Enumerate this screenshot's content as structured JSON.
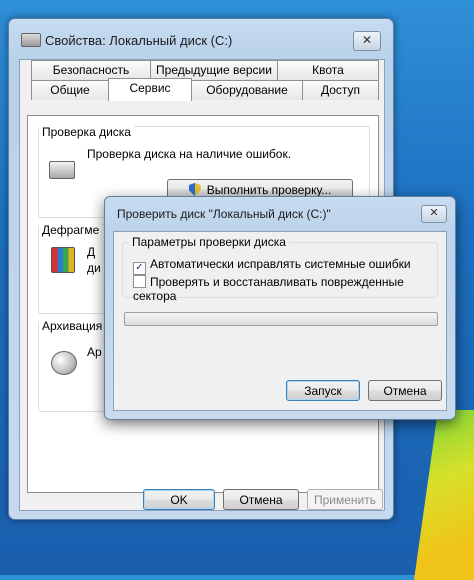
{
  "window": {
    "title": "Свойства: Локальный диск (C:)",
    "close_glyph": "✕",
    "tabs_row1": [
      "Безопасность",
      "Предыдущие версии",
      "Квота"
    ],
    "tabs_row2": [
      "Общие",
      "Сервис",
      "Оборудование",
      "Доступ"
    ],
    "active_tab": "Сервис",
    "groups": {
      "check": {
        "title": "Проверка диска",
        "desc": "Проверка диска на наличие ошибок.",
        "button": "Выполнить проверку..."
      },
      "defrag": {
        "title": "Дефрагме",
        "desc_line1": "Д",
        "desc_line2": "ди"
      },
      "backup": {
        "title": "Архивация",
        "desc": "Ар"
      }
    },
    "buttons": {
      "ok": "OK",
      "cancel": "Отмена",
      "apply": "Применить"
    }
  },
  "dialog": {
    "title": "Проверить диск \"Локальный диск (C:)\"",
    "close_glyph": "✕",
    "group_title": "Параметры проверки диска",
    "options": [
      {
        "label": "Автоматически исправлять системные ошибки",
        "checked": true,
        "mark": "✓"
      },
      {
        "label": "Проверять и восстанавливать поврежденные сектора",
        "checked": false,
        "mark": ""
      }
    ],
    "progress": 0,
    "buttons": {
      "start": "Запуск",
      "cancel": "Отмена"
    }
  },
  "colors": {
    "desktop": "#1c6fc0",
    "progress_fill": "#2fbf3a",
    "default_border": "#3c7fb1"
  }
}
